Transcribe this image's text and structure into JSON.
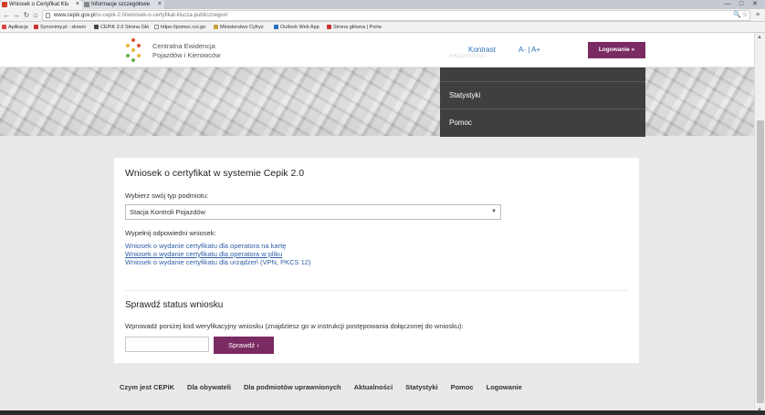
{
  "browser": {
    "tabs": [
      {
        "title": "Wniosek o Certyfikat Klu",
        "fav_color": "#d13c2b"
      },
      {
        "title": "Informacje szczegółowe",
        "fav_color": "#888888"
      }
    ],
    "window_controls": [
      "—",
      "□",
      "✕"
    ],
    "url_domain": "www.cepik.gov.pl",
    "url_path": "/si-cepik-2.0/wniosek-o-certyfikat-klucza-publicznego#/",
    "bookmarks": [
      {
        "label": "Aplikacje",
        "color": "#d44"
      },
      {
        "label": "Synonimy.pl - słowni",
        "color": "#c33"
      },
      {
        "label": "CEPiK 2.0 Strona Głó",
        "color": "#444"
      },
      {
        "label": "https://pomoc.coi.go",
        "color": "#888"
      },
      {
        "label": "Ministerstwo Cyfryz",
        "color": "#c9a23a"
      },
      {
        "label": "Outlook Web App",
        "color": "#2a6ebb"
      },
      {
        "label": "Strona główna | Porta",
        "color": "#c33"
      }
    ]
  },
  "header": {
    "logo_line1": "Centralna Ewidencja",
    "logo_line2": "Pojazdów i Kierowców",
    "kontrast": "Kontrast",
    "font_size": "A- | A+",
    "login": "Logowanie »"
  },
  "hero_menu": {
    "items": [
      "Aktualności",
      "Statystyki",
      "Pomoc"
    ]
  },
  "form": {
    "title": "Wniosek o certyfikat w systemie Cepik 2.0",
    "subject_label": "Wybierz swój typ podmiotu:",
    "subject_value": "Stacja Kontroli Pojazdów",
    "fill_label": "Wypełnij odpowiedni wniosek:",
    "links": [
      "Wniosek o wydanie certyfikatu dla operatora na kartę",
      "Wniosek o wydanie certyfikatu dla operatora w pliku",
      "Wniosek o wydanie certyfikatu dla urządzeń (VPN, PKCS 12)"
    ],
    "status_title": "Sprawdź status wniosku",
    "status_desc": "Wprowadź poniżej kod weryfikacyjny wniosku (znajdziesz go w instrukcji postępowania dołączonej do wniosku):",
    "code_value": "",
    "check_button": "Sprawdź  ›"
  },
  "footer": {
    "links": [
      "Czym jest CEPiK",
      "Dla obywateli",
      "Dla podmiotów uprawnionych",
      "Aktualności",
      "Statystyki",
      "Pomoc",
      "Logowanie"
    ]
  }
}
